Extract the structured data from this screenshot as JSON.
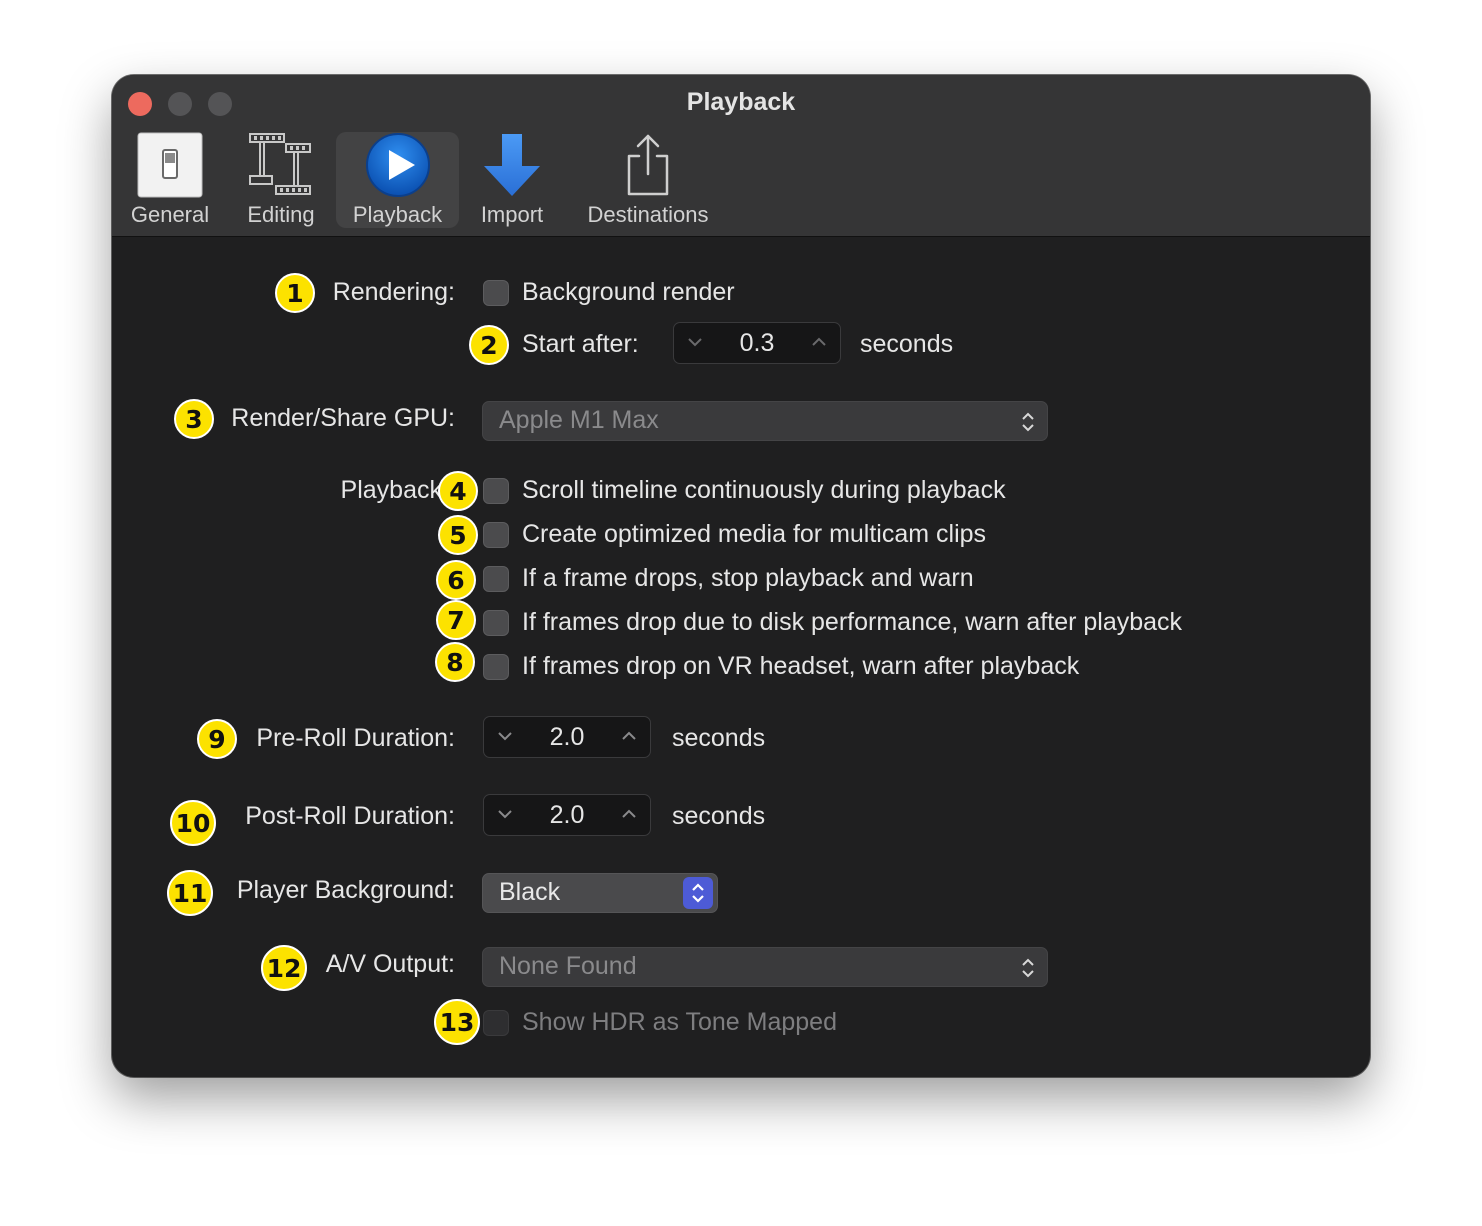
{
  "window": {
    "title": "Playback"
  },
  "toolbar": {
    "tabs": [
      {
        "label": "General",
        "icon": "general-switch-icon"
      },
      {
        "label": "Editing",
        "icon": "editing-film-icon"
      },
      {
        "label": "Playback",
        "icon": "playback-play-icon",
        "selected": true
      },
      {
        "label": "Import",
        "icon": "import-arrow-icon"
      },
      {
        "label": "Destinations",
        "icon": "share-icon"
      }
    ]
  },
  "settings": {
    "rendering_label": "Rendering:",
    "background_render_label": "Background render",
    "background_render_checked": false,
    "start_after_label": "Start after:",
    "start_after_value": "0.3",
    "start_after_unit": "seconds",
    "gpu_label": "Render/Share GPU:",
    "gpu_value": "Apple M1 Max",
    "playback_label": "Playback",
    "options": [
      {
        "label": "Scroll timeline continuously during playback",
        "checked": false
      },
      {
        "label": "Create optimized media for multicam clips",
        "checked": false
      },
      {
        "label": "If a frame drops, stop playback and warn",
        "checked": false
      },
      {
        "label": "If frames drop due to disk performance, warn after playback",
        "checked": false
      },
      {
        "label": "If frames drop on VR headset, warn after playback",
        "checked": false
      }
    ],
    "preroll_label": "Pre-Roll Duration:",
    "preroll_value": "2.0",
    "preroll_unit": "seconds",
    "postroll_label": "Post-Roll Duration:",
    "postroll_value": "2.0",
    "postroll_unit": "seconds",
    "player_bg_label": "Player Background:",
    "player_bg_value": "Black",
    "av_output_label": "A/V Output:",
    "av_output_value": "None Found",
    "hdr_label": "Show HDR as Tone Mapped",
    "hdr_checked": false
  },
  "annotations": [
    "1",
    "2",
    "3",
    "4",
    "5",
    "6",
    "7",
    "8",
    "9",
    "10",
    "11",
    "12",
    "13"
  ],
  "colors": {
    "badge": "#fce200",
    "window_bg": "#1f1f20",
    "toolbar_bg": "#353536",
    "accent": "#4d5bd6"
  }
}
